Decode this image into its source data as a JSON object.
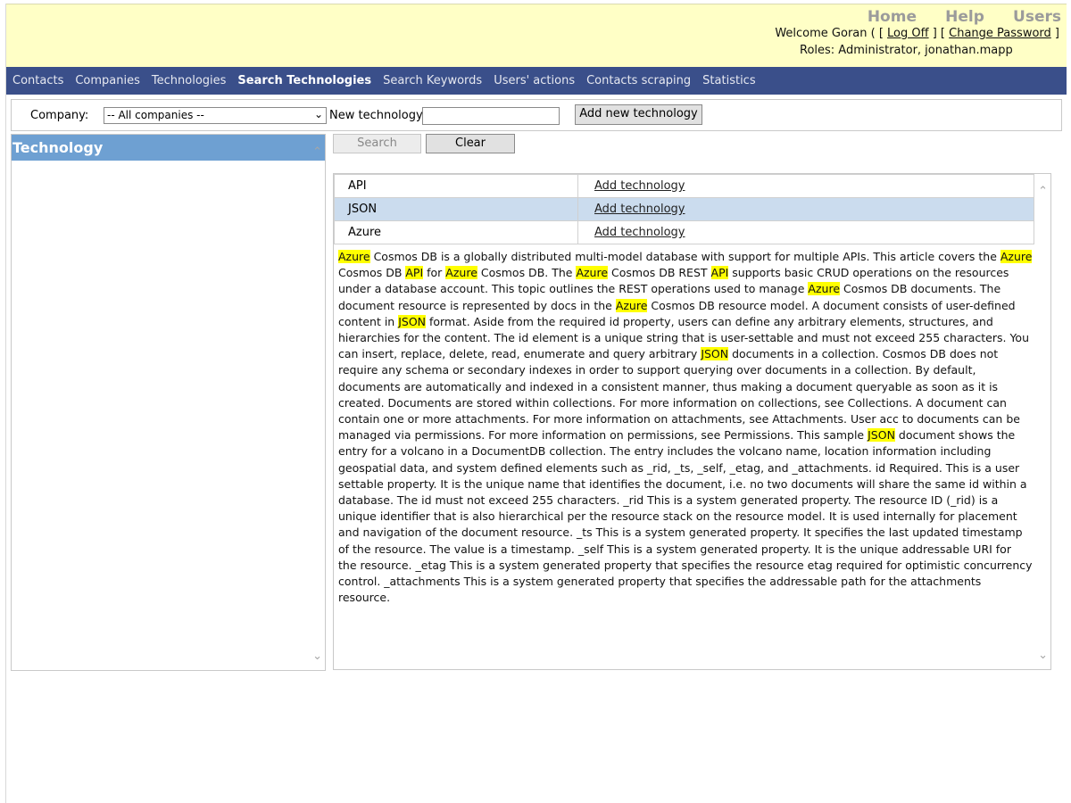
{
  "top_links": [
    "Home",
    "Help",
    "Users"
  ],
  "welcome": {
    "prefix": "Welcome Goran ( [ ",
    "log_off": "Log Off",
    "middle": " ] [ ",
    "change_password": "Change Password",
    "suffix": " ]"
  },
  "roles": "Roles: Administrator, jonathan.mapp",
  "nav": {
    "items": [
      "Contacts",
      "Companies",
      "Technologies",
      "Search Technologies",
      "Search Keywords",
      "Users' actions",
      "Contacts scraping",
      "Statistics"
    ],
    "active": "Search Technologies"
  },
  "toolbar": {
    "company_label": "Company:",
    "company_value": "-- All companies --",
    "new_tech_label": "New technology:",
    "new_tech_value": "",
    "add_button": "Add new technology"
  },
  "left_panel": {
    "header": "Technology"
  },
  "search_button": "Search",
  "clear_button": "Clear",
  "technologies": [
    {
      "name": "API",
      "action": "Add technology",
      "selected": false
    },
    {
      "name": "JSON",
      "action": "Add technology",
      "selected": true
    },
    {
      "name": "Azure",
      "action": "Add technology",
      "selected": false
    }
  ],
  "highlight_color": "#ffff00",
  "highlight_terms": [
    "Azure",
    "API",
    "JSON"
  ],
  "document_text": "Azure Cosmos DB is a globally distributed multi-model database with support for multiple APIs. This article covers the Azure Cosmos DB API for Azure Cosmos DB. The Azure Cosmos DB REST API supports basic CRUD operations on the resources under a database account. This topic outlines the REST operations used to manage Azure Cosmos DB documents. The document resource is represented by docs in the Azure Cosmos DB resource model. A document consists of user-defined content in JSON format. Aside from the required id property, users can define any arbitrary elements, structures, and hierarchies for the content. The id element is a unique string that is user-settable and must not exceed 255 characters. You can insert, replace, delete, read, enumerate and query arbitrary JSON documents in a collection. Cosmos DB does not require any schema or secondary indexes in order to support querying over documents in a collection. By default, documents are automatically and indexed in a consistent manner, thus making a document queryable as soon as it is created. Documents are stored within collections. For more information on collections, see Collections. A document can contain one or more attachments. For more information on attachments, see Attachments. User acc to documents can be managed via permissions. For more information on permissions, see Permissions. This sample JSON document shows the entry for a volcano in a DocumentDB collection. The entry includes the volcano name, location information including geospatial data, and system defined elements such as _rid, _ts, _self, _etag, and _attachments. id Required. This is a user settable property. It is the unique name that identifies the document, i.e. no two documents will share the same id within a database. The id must not exceed 255 characters. _rid This is a system generated property. The resource ID (_rid) is a unique identifier that is also hierarchical per the resource stack on the resource model. It is used internally for placement and navigation of the document resource. _ts This is a system generated property. It specifies the last updated timestamp of the resource. The value is a timestamp. _self This is a system generated property. It is the unique addressable URI for the resource. _etag This is a system generated property that specifies the resource etag required for optimistic concurrency control. _attachments This is a system generated property that specifies the addressable path for the attachments resource."
}
